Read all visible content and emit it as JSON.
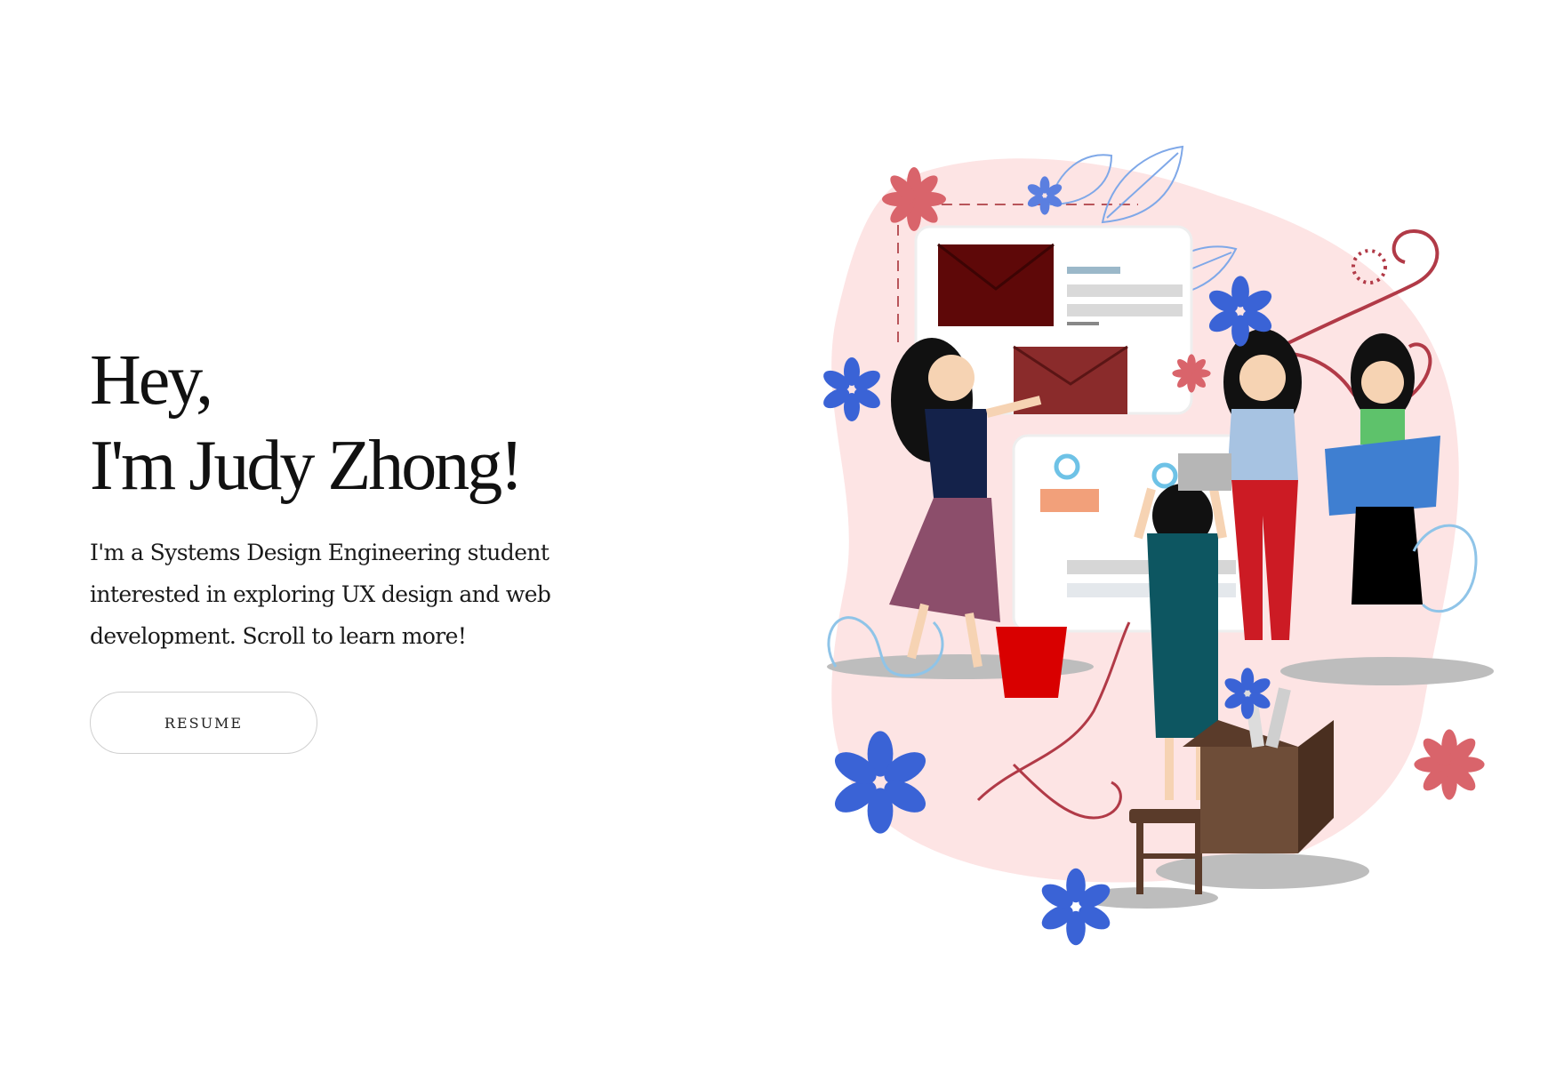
{
  "hero": {
    "greeting_line_1": "Hey,",
    "greeting_line_2": "I'm Judy Zhong!",
    "intro": "I'm a Systems Design Engineering student interested in exploring UX design and web development. Scroll to learn more!",
    "resume_label": "RESUME"
  },
  "colors": {
    "background": "#ffffff",
    "blob": "#fde4e4",
    "envelope": "#7a0b0b",
    "flower_red": "#d9646b",
    "flower_blue": "#3a63d6"
  },
  "illustration": {
    "icons": [
      "flower-icon",
      "envelope-icon",
      "leaf-icon",
      "swirl-icon",
      "bucket-icon",
      "box-icon",
      "stool-icon"
    ]
  }
}
